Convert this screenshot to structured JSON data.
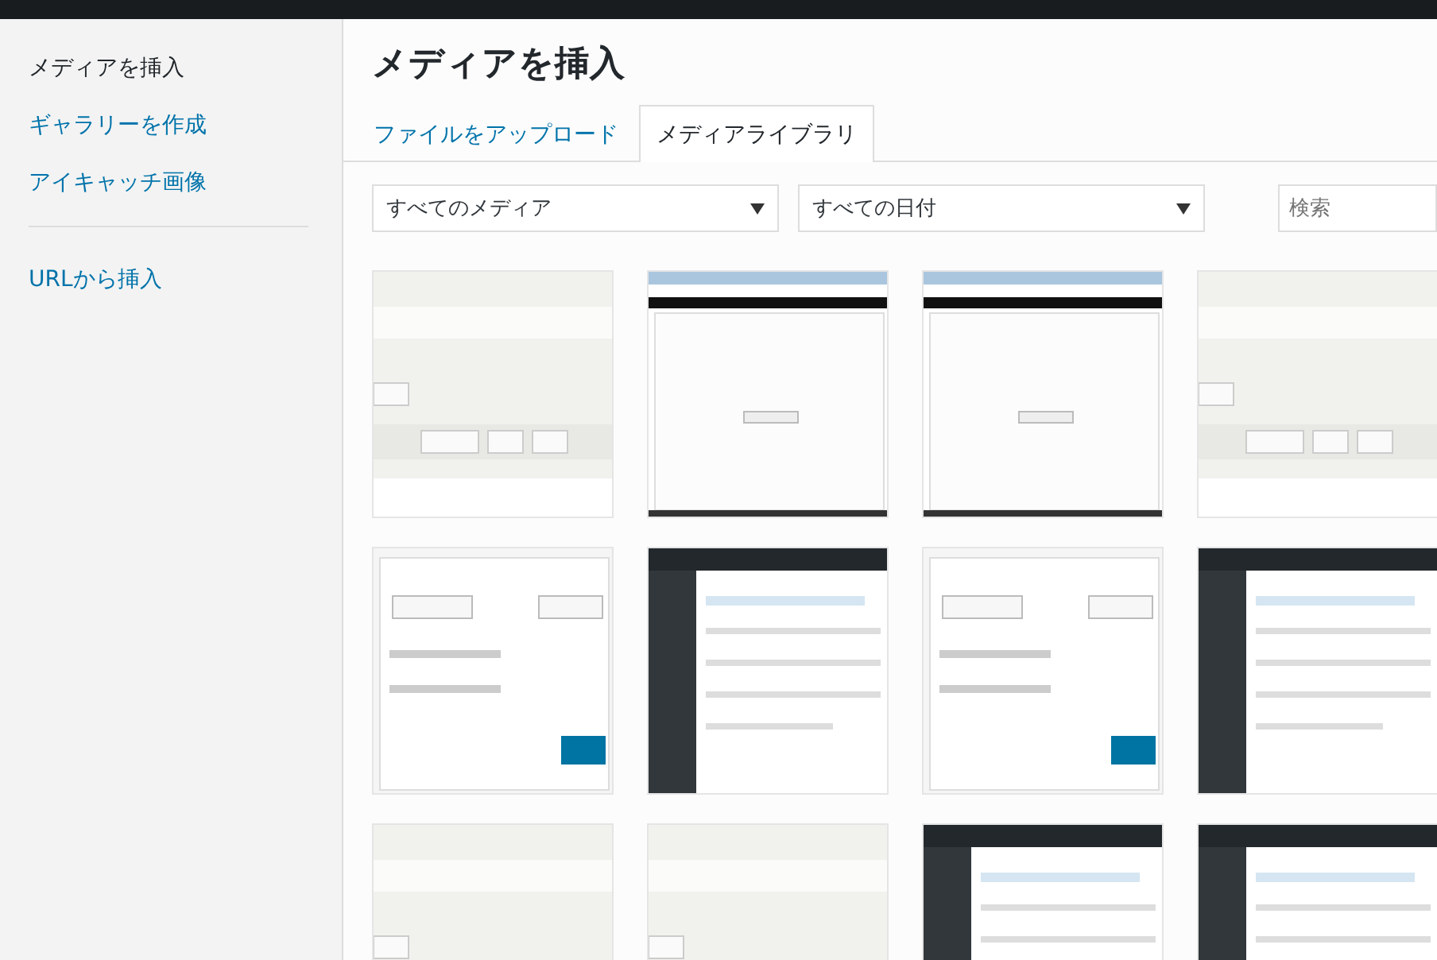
{
  "sidebar": {
    "items": [
      {
        "label": "メディアを挿入",
        "selected": true
      },
      {
        "label": "ギャラリーを作成",
        "selected": false
      },
      {
        "label": "アイキャッチ画像",
        "selected": false
      }
    ],
    "secondary_items": [
      {
        "label": "URLから挿入",
        "selected": false
      }
    ]
  },
  "title": "メディアを挿入",
  "tabs": [
    {
      "label": "ファイルをアップロード",
      "selected": false
    },
    {
      "label": "メディアライブラリ",
      "selected": true
    }
  ],
  "filters": [
    {
      "value": "すべてのメディア"
    },
    {
      "value": "すべての日付"
    }
  ],
  "search": {
    "placeholder": "検索"
  }
}
